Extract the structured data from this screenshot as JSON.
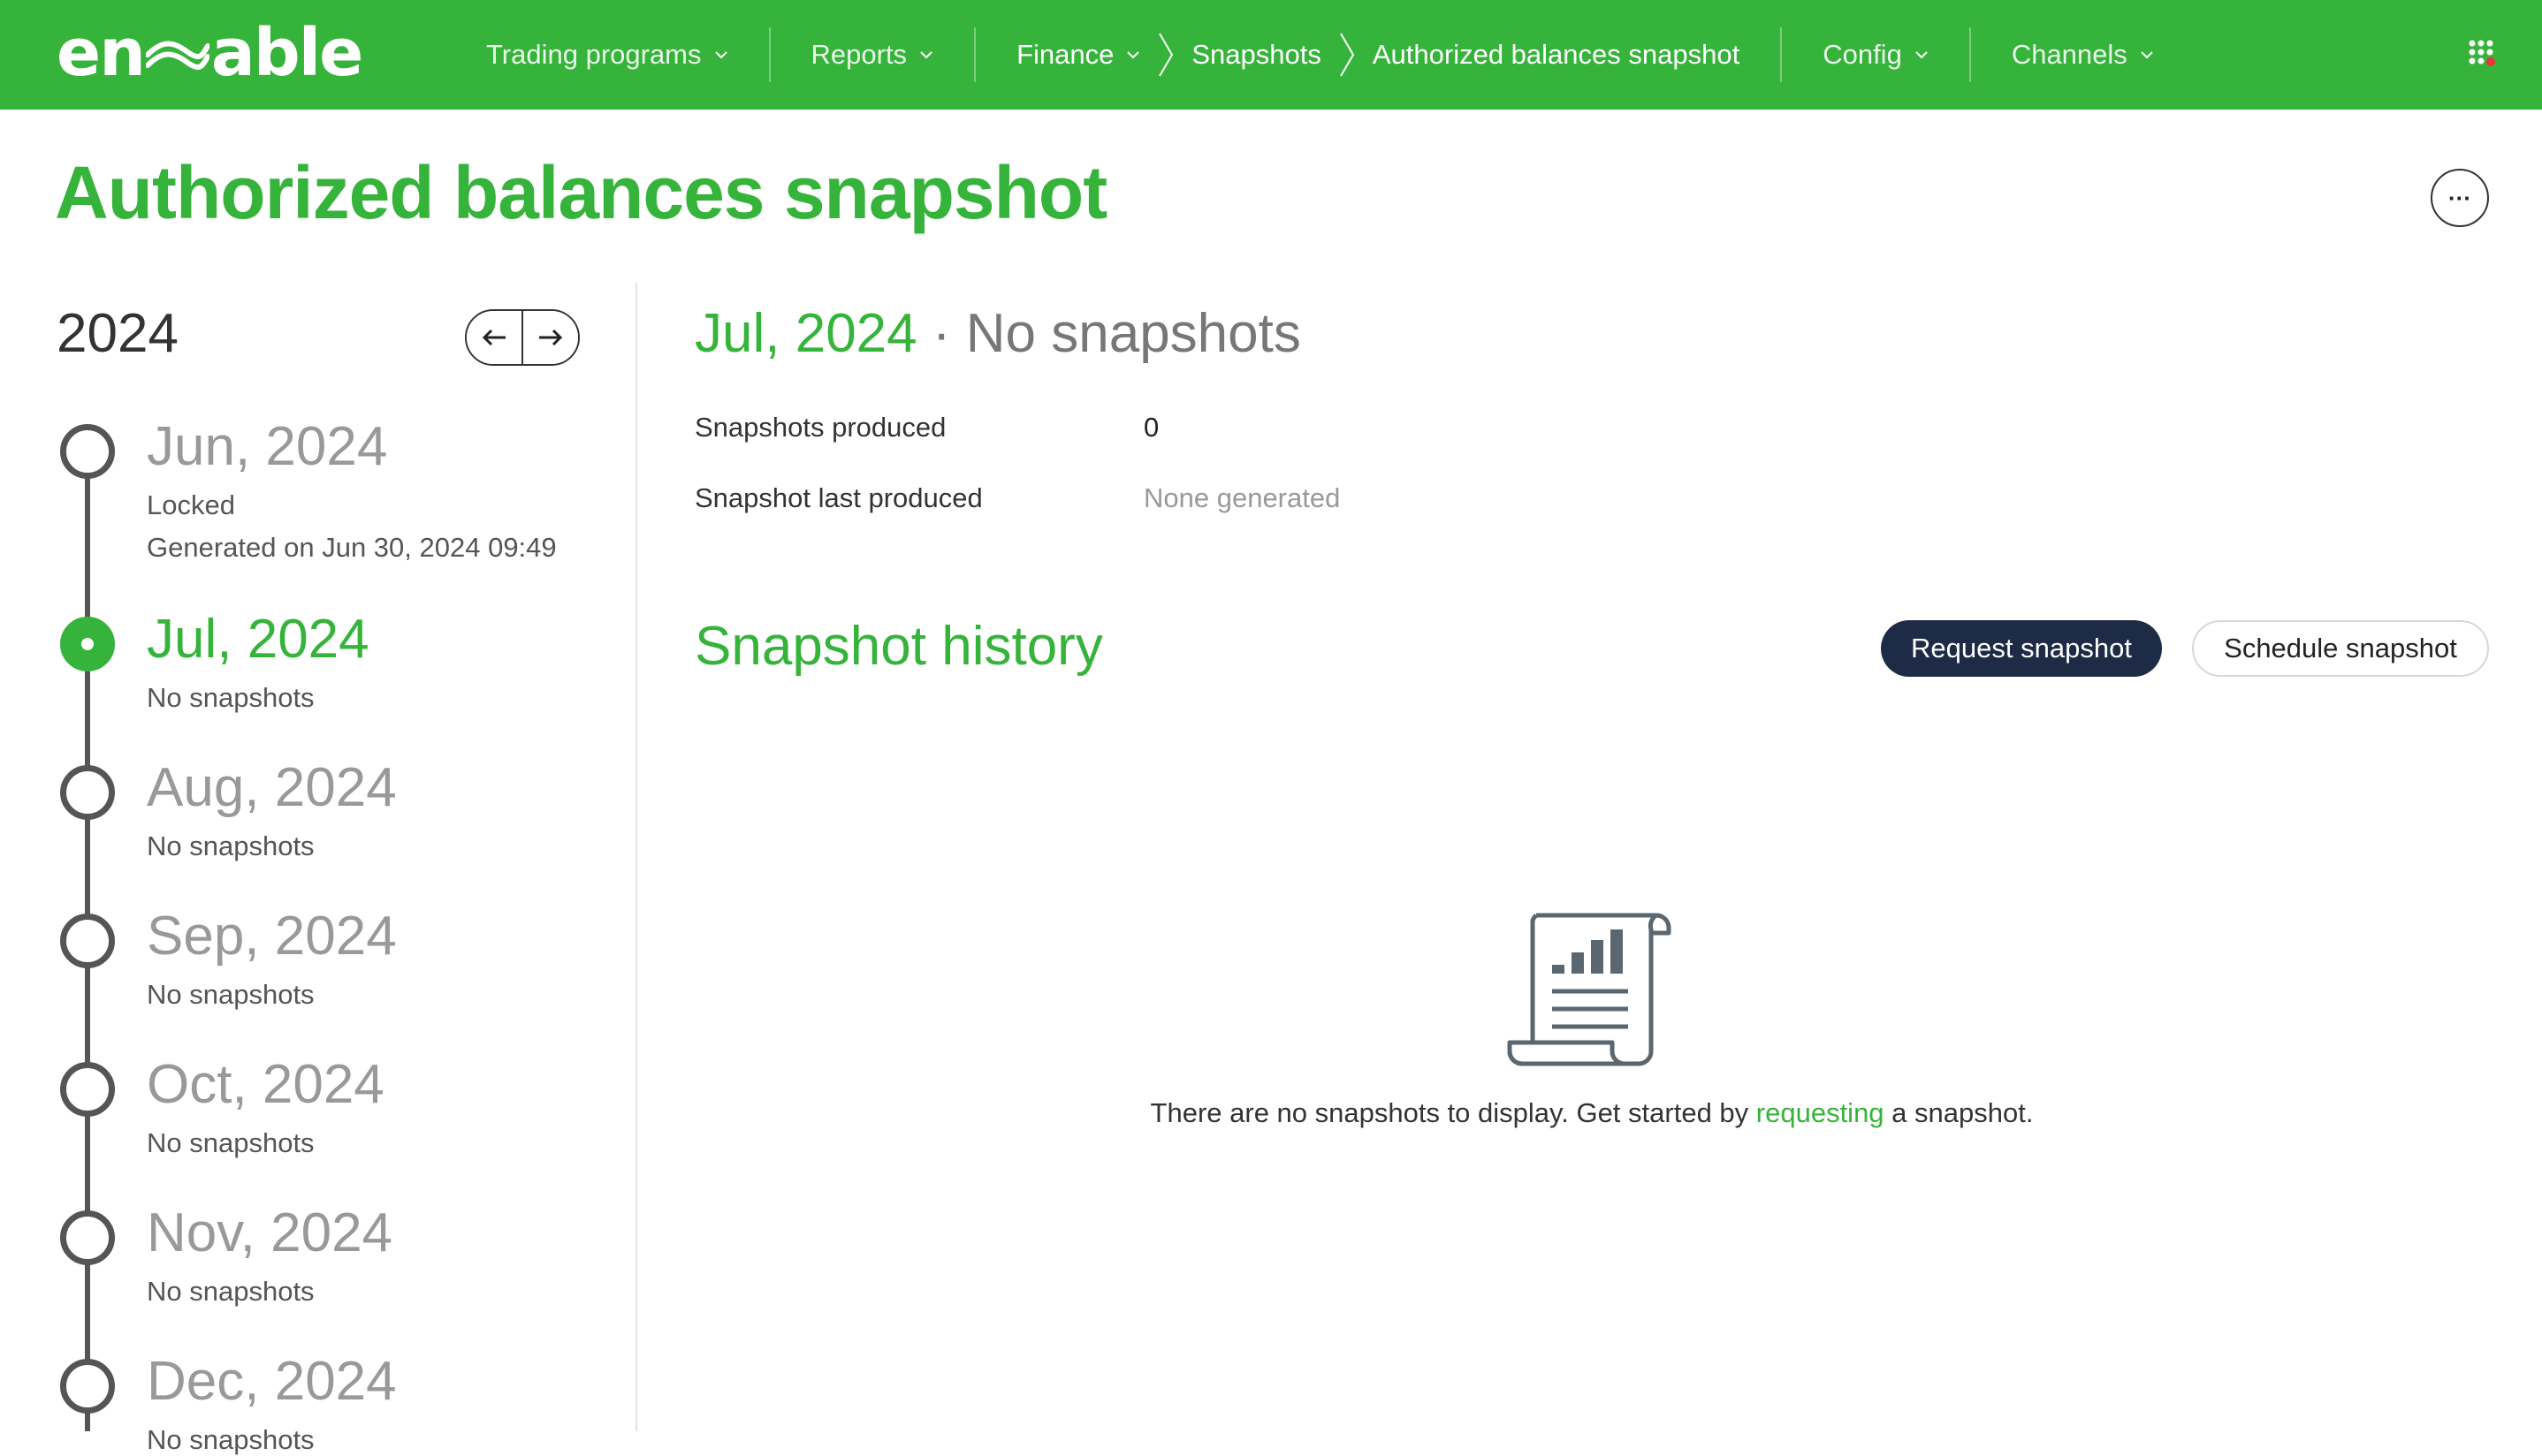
{
  "brand": {
    "logo_left": "en",
    "logo_right": "able",
    "accent": "#36b33a",
    "dark": "#1d2b47"
  },
  "nav": {
    "items": [
      {
        "label": "Trading programs"
      },
      {
        "label": "Reports"
      }
    ],
    "breadcrumb": [
      {
        "label": "Finance"
      },
      {
        "label": "Snapshots"
      },
      {
        "label": "Authorized balances snapshot"
      }
    ],
    "right_items": [
      {
        "label": "Config"
      },
      {
        "label": "Channels"
      }
    ],
    "apps_icon": "apps-grid-icon"
  },
  "page": {
    "title": "Authorized balances snapshot",
    "more_label": "···"
  },
  "sidebar": {
    "year": "2024",
    "months": [
      {
        "name": "Jun, 2024",
        "status": "Locked",
        "detail": "Generated on Jun 30, 2024 09:49",
        "active": false
      },
      {
        "name": "Jul, 2024",
        "status": "No snapshots",
        "active": true
      },
      {
        "name": "Aug, 2024",
        "status": "No snapshots",
        "active": false
      },
      {
        "name": "Sep, 2024",
        "status": "No snapshots",
        "active": false
      },
      {
        "name": "Oct, 2024",
        "status": "No snapshots",
        "active": false
      },
      {
        "name": "Nov, 2024",
        "status": "No snapshots",
        "active": false
      },
      {
        "name": "Dec, 2024",
        "status": "No snapshots",
        "active": false
      }
    ]
  },
  "main": {
    "month": "Jul, 2024",
    "separator": " · ",
    "state": "No snapshots",
    "fields": [
      {
        "label": "Snapshots produced",
        "value": "0",
        "muted": false
      },
      {
        "label": "Snapshot last produced",
        "value": "None generated",
        "muted": true
      }
    ],
    "history_title": "Snapshot history",
    "request_button": "Request snapshot",
    "schedule_button": "Schedule snapshot",
    "empty_before": "There are no snapshots to display. Get started by ",
    "empty_link": "requesting",
    "empty_after": " a snapshot."
  }
}
